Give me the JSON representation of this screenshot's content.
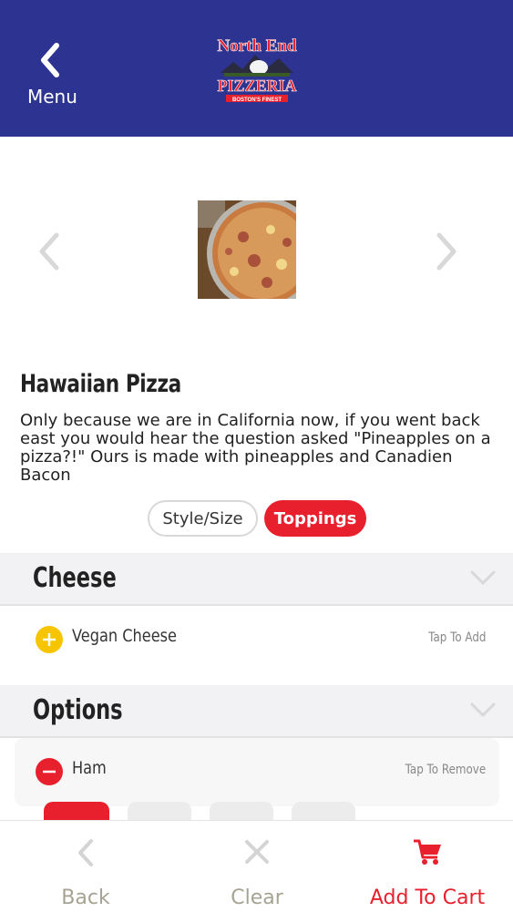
{
  "header": {
    "back_label": "Menu",
    "logo_line1": "North End",
    "logo_line2": "PIZZERIA",
    "logo_tagline": "BOSTON'S FINEST",
    "background": "#2c3391"
  },
  "item": {
    "title": "Hawaiian Pizza",
    "description": "Only because we are in California now, if you went back east you would hear the question asked \"Pineapples on a pizza?!\" Ours is made with pineapples and Canadien Bacon"
  },
  "tabs": {
    "style_size": "Style/Size",
    "toppings": "Toppings",
    "active": "Toppings"
  },
  "sections": [
    {
      "title": "Cheese",
      "items": [
        {
          "name": "Vegan Cheese",
          "action": "Tap To Add",
          "state": "add"
        }
      ]
    },
    {
      "title": "Options",
      "items": [
        {
          "name": "Ham",
          "action": "Tap To Remove",
          "state": "remove"
        }
      ]
    }
  ],
  "footer": {
    "back": "Back",
    "clear": "Clear",
    "add_to_cart": "Add To Cart"
  },
  "colors": {
    "brand_blue": "#2c3391",
    "accent_red": "#e8202d",
    "add_yellow": "#f7c400"
  }
}
